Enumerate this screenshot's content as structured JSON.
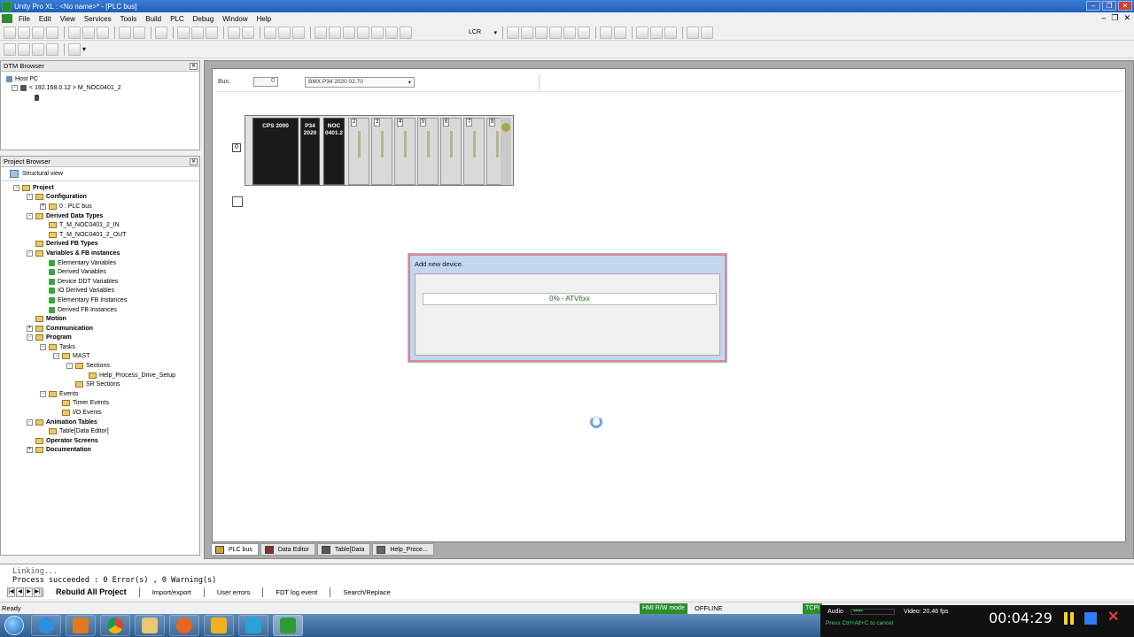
{
  "window": {
    "title": "Unity Pro XL : <No name>* - [PLC bus]"
  },
  "menu": [
    "File",
    "Edit",
    "View",
    "Services",
    "Tools",
    "Build",
    "PLC",
    "Debug",
    "Window",
    "Help"
  ],
  "toolbar": {
    "lcr_label": "LCR"
  },
  "dtm_browser": {
    "title": "DTM Browser",
    "host": "Host PC",
    "node": "< 192.168.0.12 > M_NOC0401_2"
  },
  "project_browser": {
    "title": "Project Browser",
    "view_label": "Structural view",
    "items": [
      {
        "label": "Project",
        "bold": true,
        "depth": 0,
        "exp": "-"
      },
      {
        "label": "Configuration",
        "bold": true,
        "depth": 1,
        "exp": "-"
      },
      {
        "label": "0 : PLC bus",
        "bold": false,
        "depth": 2,
        "exp": "+"
      },
      {
        "label": "Derived Data Types",
        "bold": true,
        "depth": 1,
        "exp": "-"
      },
      {
        "label": "T_M_NOC0401_2_IN",
        "bold": false,
        "depth": 2,
        "exp": ""
      },
      {
        "label": "T_M_NOC0401_2_OUT",
        "bold": false,
        "depth": 2,
        "exp": ""
      },
      {
        "label": "Derived FB Types",
        "bold": true,
        "depth": 1,
        "exp": ""
      },
      {
        "label": "Variables & FB instances",
        "bold": true,
        "depth": 1,
        "exp": "-"
      },
      {
        "label": "Elementary Variables",
        "bold": false,
        "depth": 2,
        "exp": "",
        "leaf": true
      },
      {
        "label": "Derived Variables",
        "bold": false,
        "depth": 2,
        "exp": "",
        "leaf": true
      },
      {
        "label": "Device DDT Variables",
        "bold": false,
        "depth": 2,
        "exp": "",
        "leaf": true
      },
      {
        "label": "IO Derived Variables",
        "bold": false,
        "depth": 2,
        "exp": "",
        "leaf": true
      },
      {
        "label": "Elementary FB Instances",
        "bold": false,
        "depth": 2,
        "exp": "",
        "leaf": true
      },
      {
        "label": "Derived FB Instances",
        "bold": false,
        "depth": 2,
        "exp": "",
        "leaf": true
      },
      {
        "label": "Motion",
        "bold": true,
        "depth": 1,
        "exp": ""
      },
      {
        "label": "Communication",
        "bold": true,
        "depth": 1,
        "exp": "+"
      },
      {
        "label": "Program",
        "bold": true,
        "depth": 1,
        "exp": "-"
      },
      {
        "label": "Tasks",
        "bold": false,
        "depth": 2,
        "exp": "-"
      },
      {
        "label": "MAST",
        "bold": false,
        "depth": 3,
        "exp": "-"
      },
      {
        "label": "Sections",
        "bold": false,
        "depth": 4,
        "exp": "-"
      },
      {
        "label": "Help_Process_Drive_Setup",
        "bold": false,
        "depth": 5,
        "exp": ""
      },
      {
        "label": "SR Sections",
        "bold": false,
        "depth": 4,
        "exp": ""
      },
      {
        "label": "Events",
        "bold": false,
        "depth": 2,
        "exp": "-"
      },
      {
        "label": "Timer Events",
        "bold": false,
        "depth": 3,
        "exp": ""
      },
      {
        "label": "I/O Events",
        "bold": false,
        "depth": 3,
        "exp": ""
      },
      {
        "label": "Animation Tables",
        "bold": true,
        "depth": 1,
        "exp": "-"
      },
      {
        "label": "Table[Data Editor]",
        "bold": false,
        "depth": 2,
        "exp": ""
      },
      {
        "label": "Operator Screens",
        "bold": true,
        "depth": 1,
        "exp": ""
      },
      {
        "label": "Documentation",
        "bold": true,
        "depth": 1,
        "exp": "+"
      }
    ]
  },
  "plc_bus": {
    "bus_label": "Bus:",
    "bus_number": "0",
    "cpu_selector": "BMX P34 2020   02.70",
    "rack_number": "0",
    "modules": {
      "cps": "CPS 2000",
      "p34": "P34 2020",
      "noc": "NOC 0401.2"
    },
    "slot_numbers": [
      "0",
      "1",
      "2",
      "3",
      "4",
      "5",
      "6",
      "7",
      "8"
    ]
  },
  "dialog": {
    "title": "Add new device.",
    "progress_text": "0% - ATV6xx",
    "progress_fraction": 0
  },
  "doc_tabs": [
    "PLC bus",
    "Data Editor",
    "Table[Data",
    "Help_Proce..."
  ],
  "output": {
    "line1": "Linking...",
    "line2": "Process succeeded : 0 Error(s) , 0 Warning(s)",
    "tabs": [
      "Rebuild All Project",
      "Import/export",
      "User errors",
      "FDT log event",
      "Search/Replace"
    ]
  },
  "status": {
    "left": "Ready",
    "hmi_mode": "HMI R/W mode",
    "connection": "OFFLINE",
    "tcpip": "TCPI"
  },
  "recorder": {
    "audio_label": "Audio",
    "video_label": "Video: 20.46 fps",
    "hint": "Press Ctrl+Alt+C to cancel",
    "timer": "00:04:29"
  },
  "colors": {
    "accent_green": "#2b8f2b",
    "progress_text": "#1a6b1a",
    "title_blue": "#1f5fb8"
  }
}
